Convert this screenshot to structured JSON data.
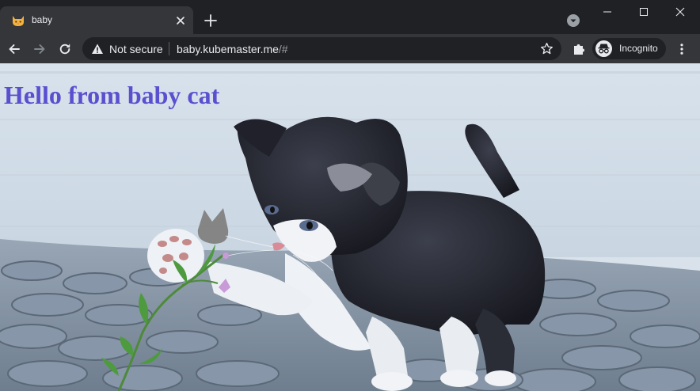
{
  "tab": {
    "title": "baby",
    "favicon": "cat-face-icon"
  },
  "toolbar": {
    "security_label": "Not secure",
    "url_host": "baby.kubemaster.me",
    "url_rest": "/#",
    "incognito_label": "Incognito"
  },
  "page": {
    "heading": "Hello from baby cat",
    "heading_color": "#5a4fcf",
    "image": "kitten-photo"
  },
  "icons": {
    "back": "back-arrow-icon",
    "forward": "forward-arrow-icon",
    "reload": "reload-icon",
    "warning": "warning-icon",
    "star": "star-icon",
    "extensions": "puzzle-icon",
    "menu": "kebab-menu-icon",
    "minimize": "minimize-icon",
    "maximize": "maximize-icon",
    "close": "close-icon",
    "new_tab": "plus-icon",
    "tab_search": "tab-search-icon"
  },
  "colors": {
    "frame": "#202124",
    "toolbar": "#35363a",
    "text": "#e8eaed"
  }
}
